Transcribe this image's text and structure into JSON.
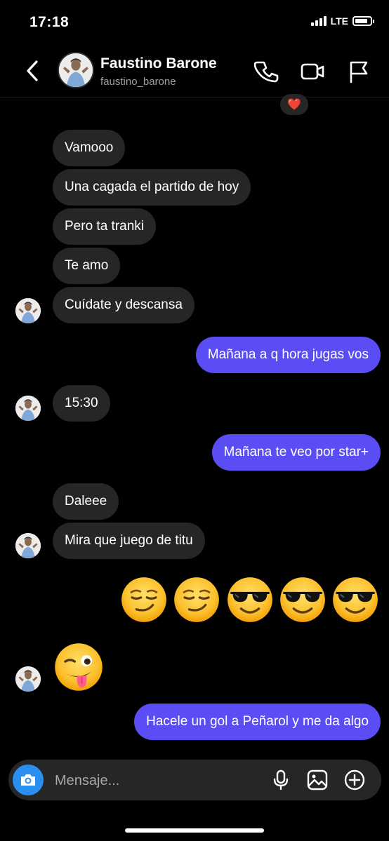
{
  "status_bar": {
    "time": "17:18",
    "network": "LTE",
    "battery_level": 0.85
  },
  "header": {
    "name": "Faustino Barone",
    "handle": "faustino_barone",
    "icons": [
      "back-chevron-icon",
      "phone-icon",
      "video-camera-icon",
      "flag-icon"
    ]
  },
  "reaction": {
    "emoji": "❤️"
  },
  "messages": [
    {
      "from": "them",
      "text": "Vamooo"
    },
    {
      "from": "them",
      "text": "Una cagada el partido de hoy"
    },
    {
      "from": "them",
      "text": "Pero ta tranki"
    },
    {
      "from": "them",
      "text": "Te amo"
    },
    {
      "from": "them",
      "text": "Cuídate y descansa"
    },
    {
      "from": "me",
      "text": "Mañana a q hora jugas vos"
    },
    {
      "from": "them",
      "text": "15:30"
    },
    {
      "from": "me",
      "text": "Mañana te veo por star+"
    },
    {
      "from": "them",
      "text": "Daleee"
    },
    {
      "from": "them",
      "text": "Mira que juego de titu"
    },
    {
      "from": "me",
      "emojis": [
        "smirk",
        "smirk",
        "sunglasses",
        "sunglasses",
        "sunglasses"
      ]
    },
    {
      "from": "them",
      "emojis": [
        "winking-tongue"
      ]
    },
    {
      "from": "me",
      "text": "Hacele un gol a Peñarol y me da algo"
    }
  ],
  "composer": {
    "placeholder": "Mensaje...",
    "icons": [
      "camera-icon",
      "microphone-icon",
      "gallery-icon",
      "add-icon"
    ]
  },
  "colors": {
    "background": "#000000",
    "incoming_bubble": "#262626",
    "outgoing_bubble": "#5a4df3",
    "camera_button": "#2b8ff0"
  }
}
